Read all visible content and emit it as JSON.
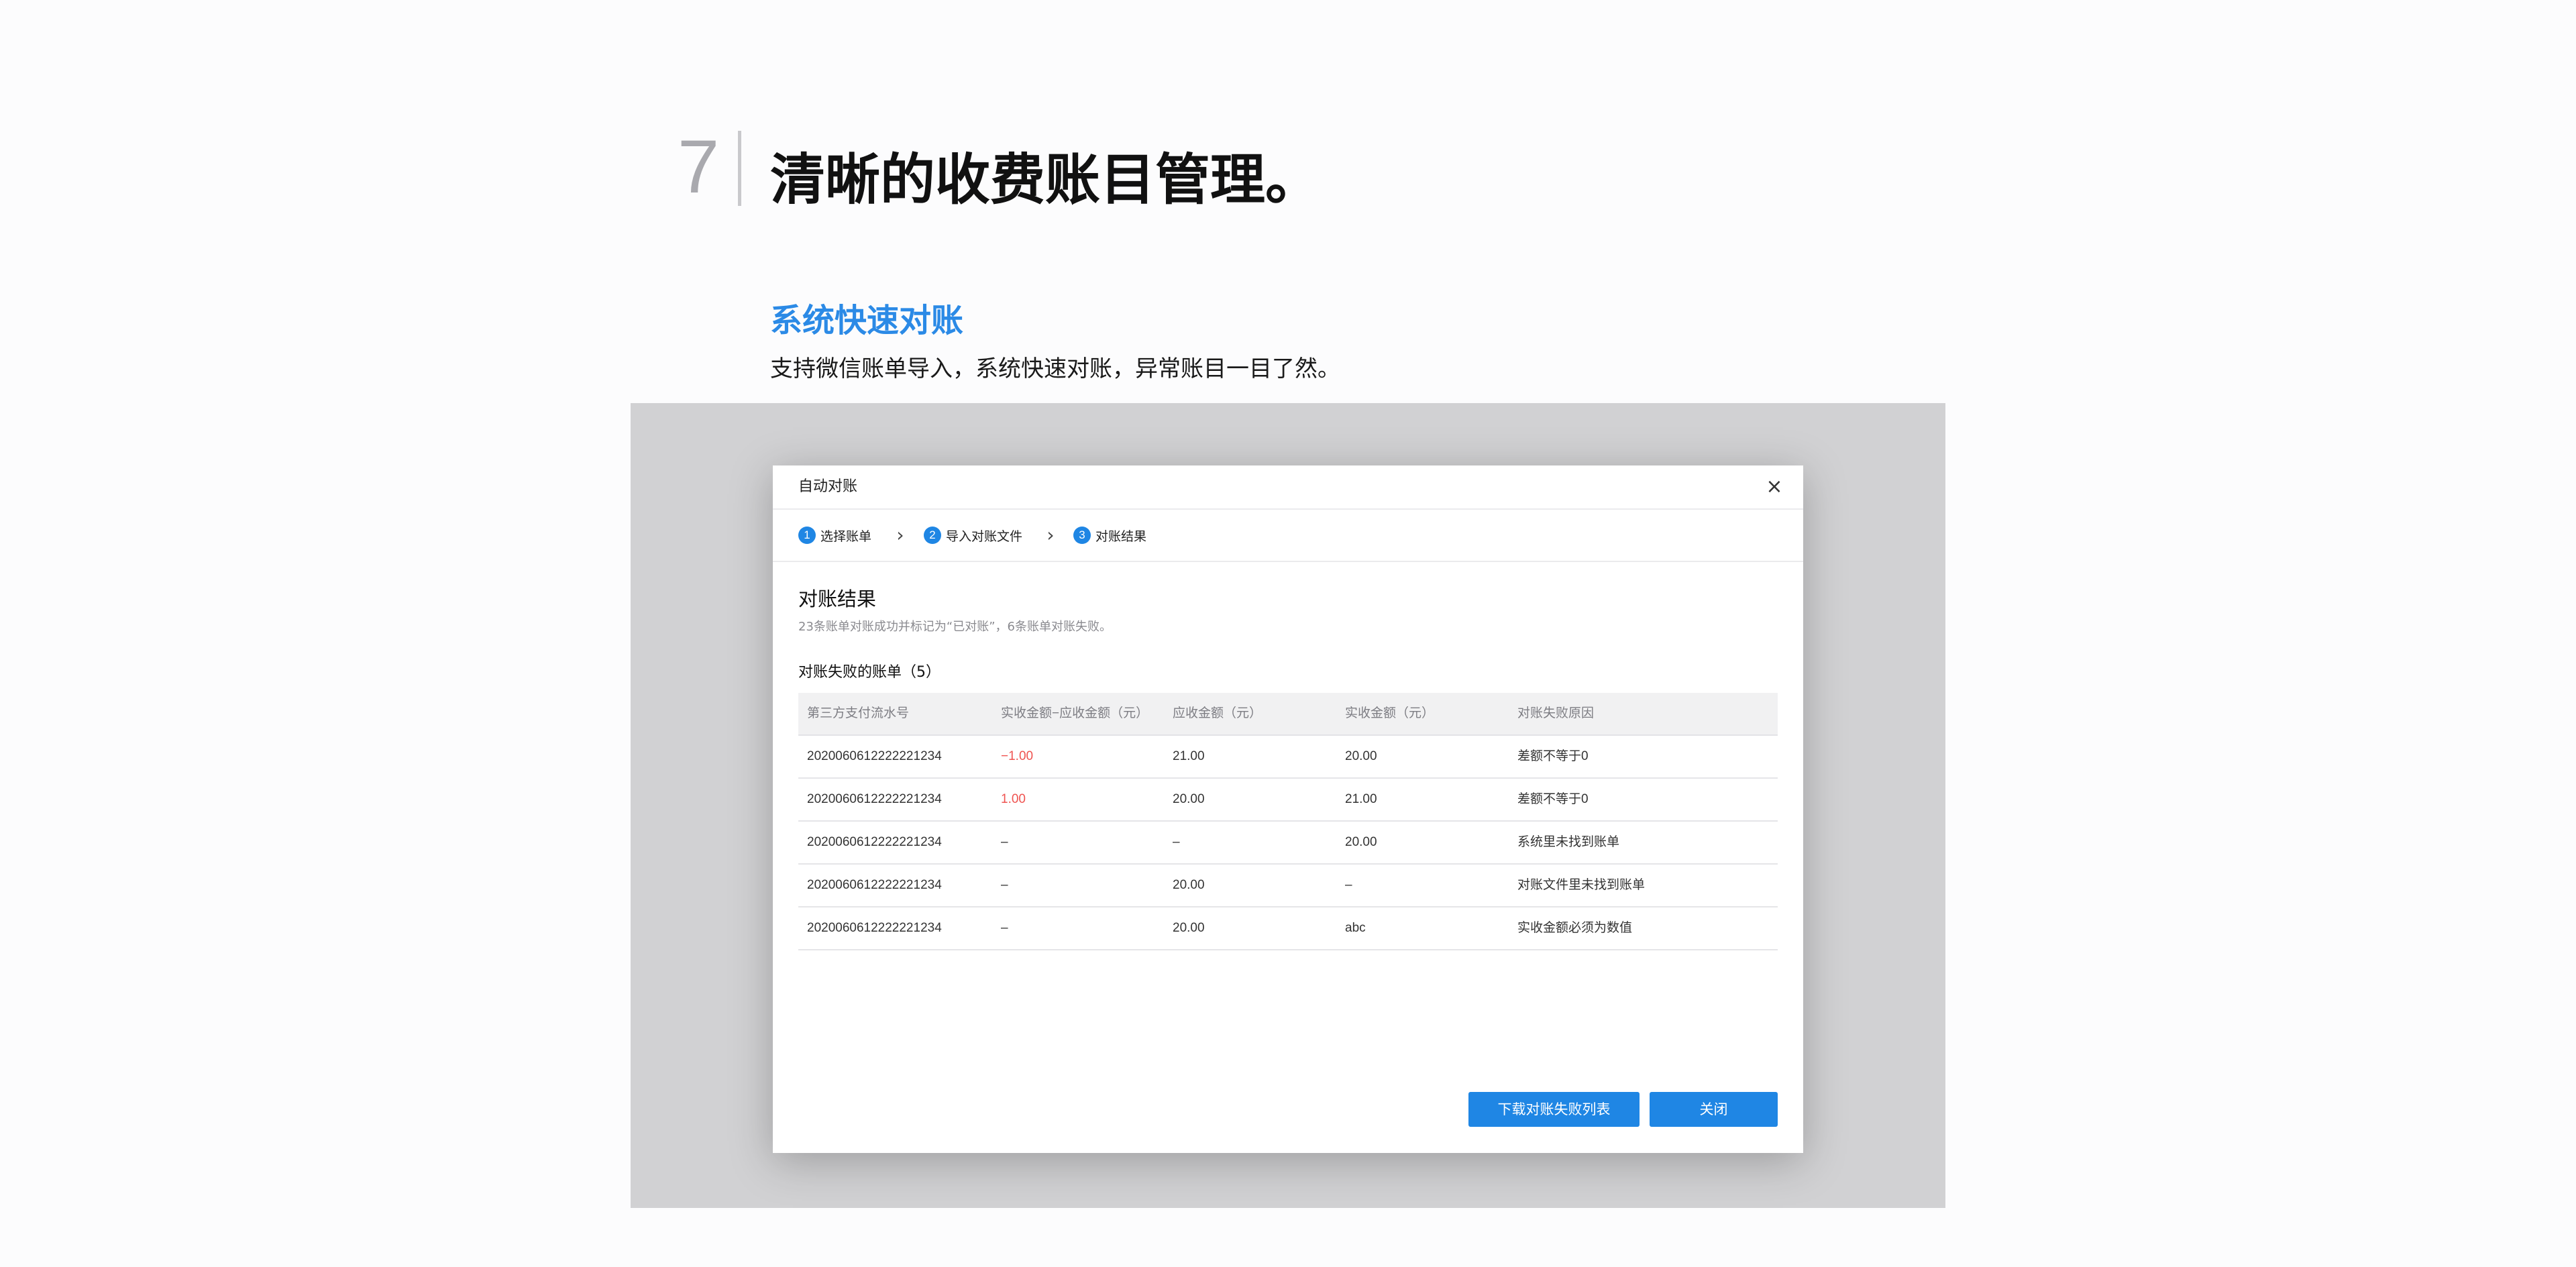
{
  "header": {
    "section_number": "7",
    "title": "清晰的收费账目管理。"
  },
  "feature": {
    "title": "系统快速对账",
    "description": "支持微信账单导入，系统快速对账，异常账目一目了然。"
  },
  "modal": {
    "title": "自动对账",
    "close_symbol": "×",
    "steps": [
      {
        "number": "1",
        "label": "选择账单"
      },
      {
        "number": "2",
        "label": "导入对账文件"
      },
      {
        "number": "3",
        "label": "对账结果"
      }
    ],
    "chevron": "›",
    "result_title": "对账结果",
    "result_summary": "23条账单对账成功并标记为“已对账”，6条账单对账失败。",
    "failed_title": "对账失败的账单（5）",
    "table": {
      "columns": [
        "第三方支付流水号",
        "实收金额−应收金额（元）",
        "应收金额（元）",
        "实收金额（元）",
        "对账失败原因"
      ],
      "rows": [
        [
          "2020060612222221234",
          "−1.00",
          "21.00",
          "20.00",
          "差额不等于0"
        ],
        [
          "2020060612222221234",
          "1.00",
          "20.00",
          "21.00",
          "差额不等于0"
        ],
        [
          "2020060612222221234",
          "–",
          "–",
          "20.00",
          "系统里未找到账单"
        ],
        [
          "2020060612222221234",
          "–",
          "20.00",
          "–",
          "对账文件里未找到账单"
        ],
        [
          "2020060612222221234",
          "–",
          "20.00",
          "abc",
          "实收金额必须为数值"
        ]
      ]
    },
    "buttons": {
      "download_label": "下载对账失败列表",
      "close_label": "关闭"
    }
  },
  "colors": {
    "accent": "#1f86e4",
    "feature_title": "#2b8ae6",
    "negative": "#ef5350",
    "stage_background": "#d1d1d3"
  },
  "icons": {
    "close": "close-icon",
    "chevron": "chevron-right-icon"
  }
}
